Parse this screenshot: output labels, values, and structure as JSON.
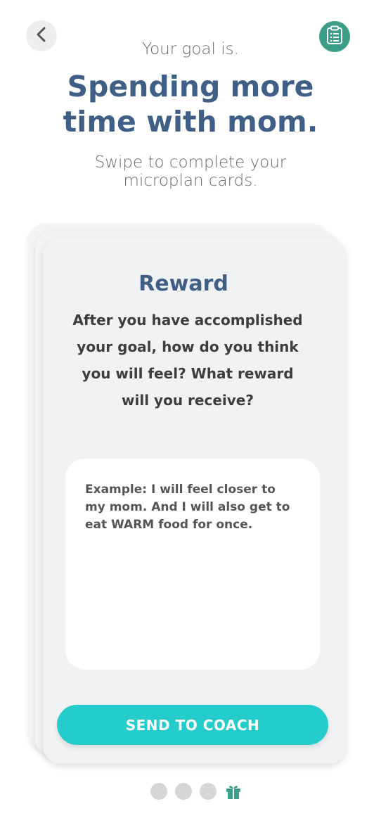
{
  "header": {
    "eyebrow": "Your goal is.",
    "goal_title": "Spending more time with mom.",
    "subtitle": "Swipe to complete your microplan cards."
  },
  "card": {
    "title": "Reward",
    "question": "After you have accomplished your goal, how do you think you will feel? What reward will you receive?",
    "answer_text": "Example: I will feel closer to my mom. And I will also get to eat WARM food for once."
  },
  "actions": {
    "send_label": "SEND TO COACH"
  },
  "icons": {
    "back": "chevron-left-icon",
    "plan": "clipboard-icon",
    "last_page": "gift-icon"
  },
  "colors": {
    "title_blue": "#3f5f86",
    "accent_green": "#3a9e88",
    "button_teal": "#24cccc",
    "dot_inactive": "#d6d6d6"
  },
  "pagination": {
    "total": 4,
    "current": 4
  }
}
